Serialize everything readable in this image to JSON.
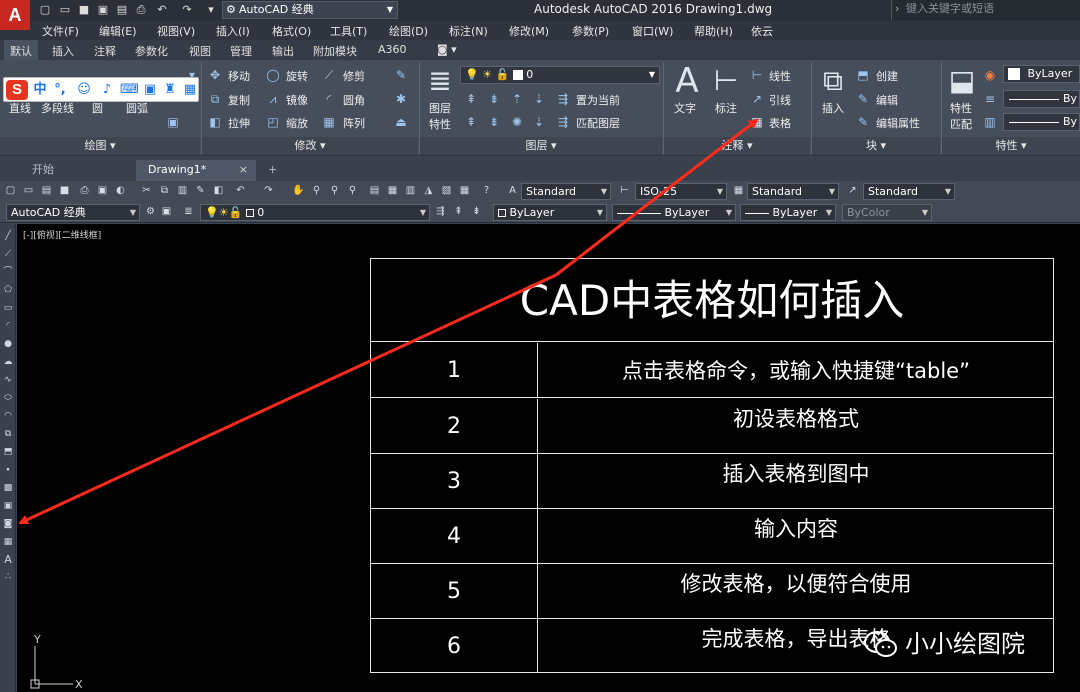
{
  "titlebar": {
    "app_logo": "A",
    "workspace": "AutoCAD 经典",
    "title": "Autodesk AutoCAD 2016    Drawing1.dwg",
    "search_placeholder": "键入关键字或短语"
  },
  "menu": [
    "文件(F)",
    "编辑(E)",
    "视图(V)",
    "插入(I)",
    "格式(O)",
    "工具(T)",
    "绘图(D)",
    "标注(N)",
    "修改(M)",
    "参数(P)",
    "窗口(W)",
    "帮助(H)",
    "依云"
  ],
  "ribbon_tabs": [
    "默认",
    "插入",
    "注释",
    "参数化",
    "视图",
    "管理",
    "输出",
    "附加模块",
    "A360"
  ],
  "ribbon": {
    "draw": {
      "title": "绘图",
      "line": "直线",
      "polyline": "多段线",
      "circle": "圆",
      "arc": "圆弧"
    },
    "modify": {
      "title": "修改",
      "move": "移动",
      "rotate": "旋转",
      "trim": "修剪",
      "copy": "复制",
      "mirror": "镜像",
      "fillet": "圆角",
      "stretch": "拉伸",
      "scale": "缩放",
      "array": "阵列"
    },
    "layers": {
      "title": "图层",
      "layer_props": "图层",
      "layer_props2": "特性",
      "layer_value": "0",
      "set_current": "置为当前",
      "match_layer": "匹配图层"
    },
    "annotation": {
      "title": "注释",
      "text": "文字",
      "dimension": "标注",
      "linear": "线性",
      "leader": "引线",
      "table": "表格"
    },
    "block": {
      "title": "块",
      "insert": "插入",
      "create": "创建",
      "edit": "编辑",
      "edit_attr": "编辑属性"
    },
    "properties": {
      "title": "特性",
      "match": "特性",
      "match2": "匹配",
      "bylayer1": "ByLayer",
      "bylayer2": "By",
      "bylayer3": "By"
    }
  },
  "file_tabs": {
    "start": "开始",
    "drawing": "Drawing1*",
    "close": "×",
    "new": "+"
  },
  "toolbar1": {
    "text_style": "Standard",
    "dim_style": "ISO-25",
    "table_style": "Standard",
    "mleader_style": "Standard"
  },
  "toolbar2": {
    "workspace": "AutoCAD 经典",
    "layer": "0",
    "color": "ByLayer",
    "linetype": "ByLayer",
    "lineweight": "ByLayer",
    "plotstyle": "ByColor"
  },
  "viewport_label": "[-][俯视][二维线框]",
  "ucs": {
    "y": "Y",
    "x": "X"
  },
  "cad_table": {
    "title": "CAD中表格如何插入",
    "rows": [
      {
        "num": "1",
        "text": "点击表格命令，或输入快捷键“table”"
      },
      {
        "num": "2",
        "text": "初设表格格式"
      },
      {
        "num": "3",
        "text": "插入表格到图中"
      },
      {
        "num": "4",
        "text": "输入内容"
      },
      {
        "num": "5",
        "text": "修改表格，以便符合使用"
      },
      {
        "num": "6",
        "text": "完成表格，导出表格"
      }
    ]
  },
  "watermark": "小小绘图院",
  "colors": {
    "arrow": "#ff2a1a",
    "canvas": "#000000",
    "ribbon": "#464e5b",
    "logo": "#c8281f"
  }
}
